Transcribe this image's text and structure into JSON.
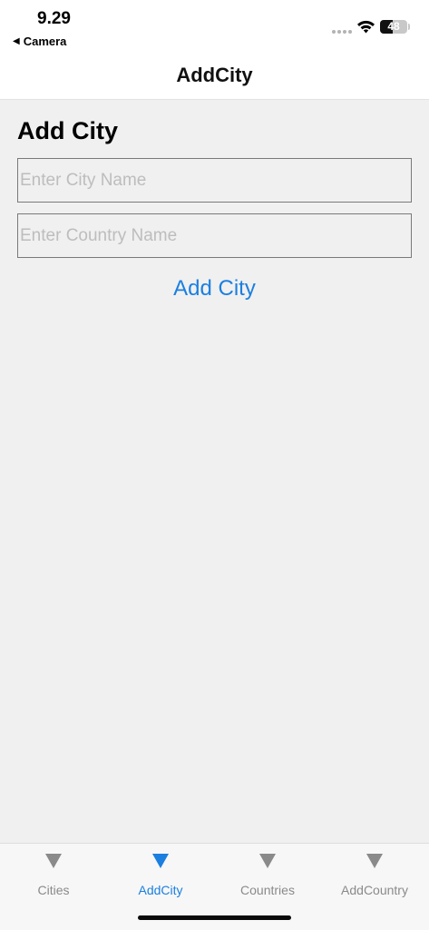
{
  "status_bar": {
    "time": "9.29",
    "back_app": "Camera",
    "battery_level": "48",
    "battery_fraction": 0.48
  },
  "nav": {
    "title": "AddCity"
  },
  "form": {
    "heading": "Add City",
    "city_input": {
      "placeholder": "Enter City Name",
      "value": ""
    },
    "country_input": {
      "placeholder": "Enter Country Name",
      "value": ""
    },
    "submit_label": "Add City"
  },
  "tab_bar": {
    "active_index": 1,
    "tabs": [
      {
        "label": "Cities",
        "icon": "triangle-down-icon"
      },
      {
        "label": "AddCity",
        "icon": "triangle-down-icon"
      },
      {
        "label": "Countries",
        "icon": "triangle-down-icon"
      },
      {
        "label": "AddCountry",
        "icon": "triangle-down-icon"
      }
    ]
  },
  "colors": {
    "accent": "#1b7fe0",
    "inactive_tab": "#8a8a8a",
    "background": "#f0f0f0"
  }
}
